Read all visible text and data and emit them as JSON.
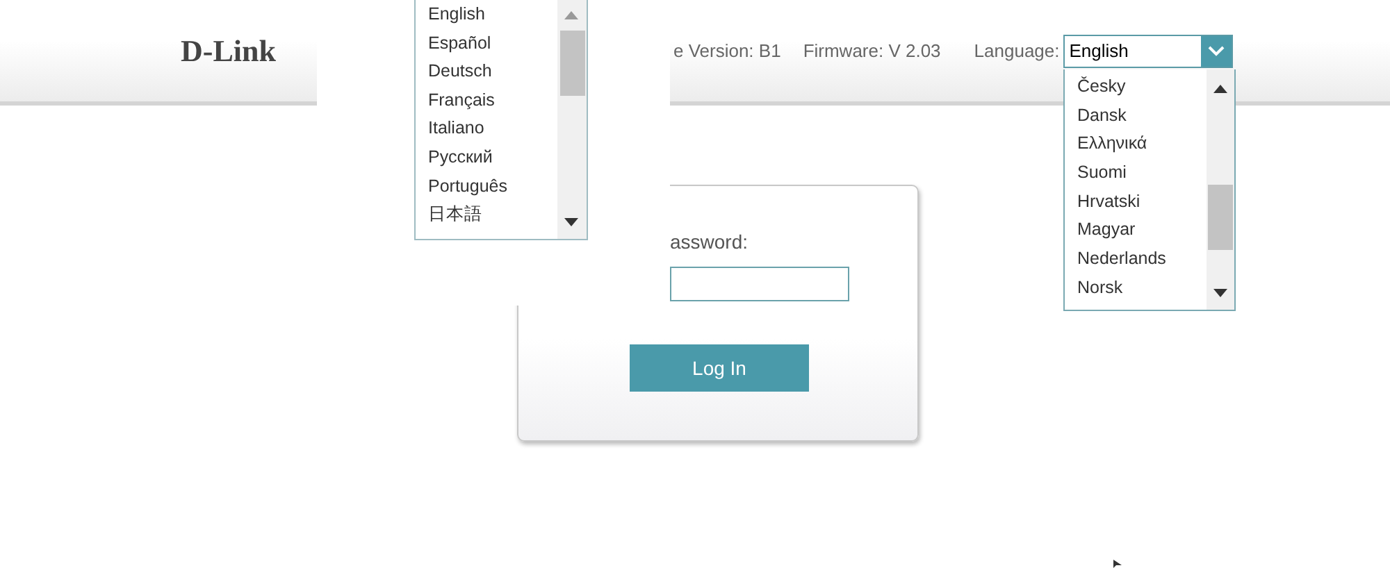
{
  "header": {
    "logo": "D-Link",
    "hardware_version": "e Version: B1",
    "firmware": "Firmware: V 2.03",
    "language_label": "Language:",
    "language_value": "English",
    "language_options": [
      "Česky",
      "Dansk",
      "Ελληνικά",
      "Suomi",
      "Hrvatski",
      "Magyar",
      "Nederlands",
      "Norsk"
    ]
  },
  "overlay_list": {
    "options": [
      "English",
      "Español",
      "Deutsch",
      "Français",
      "Italiano",
      "Русский",
      "Português",
      "日本語"
    ]
  },
  "login": {
    "label": "assword:",
    "button": "Log In"
  }
}
